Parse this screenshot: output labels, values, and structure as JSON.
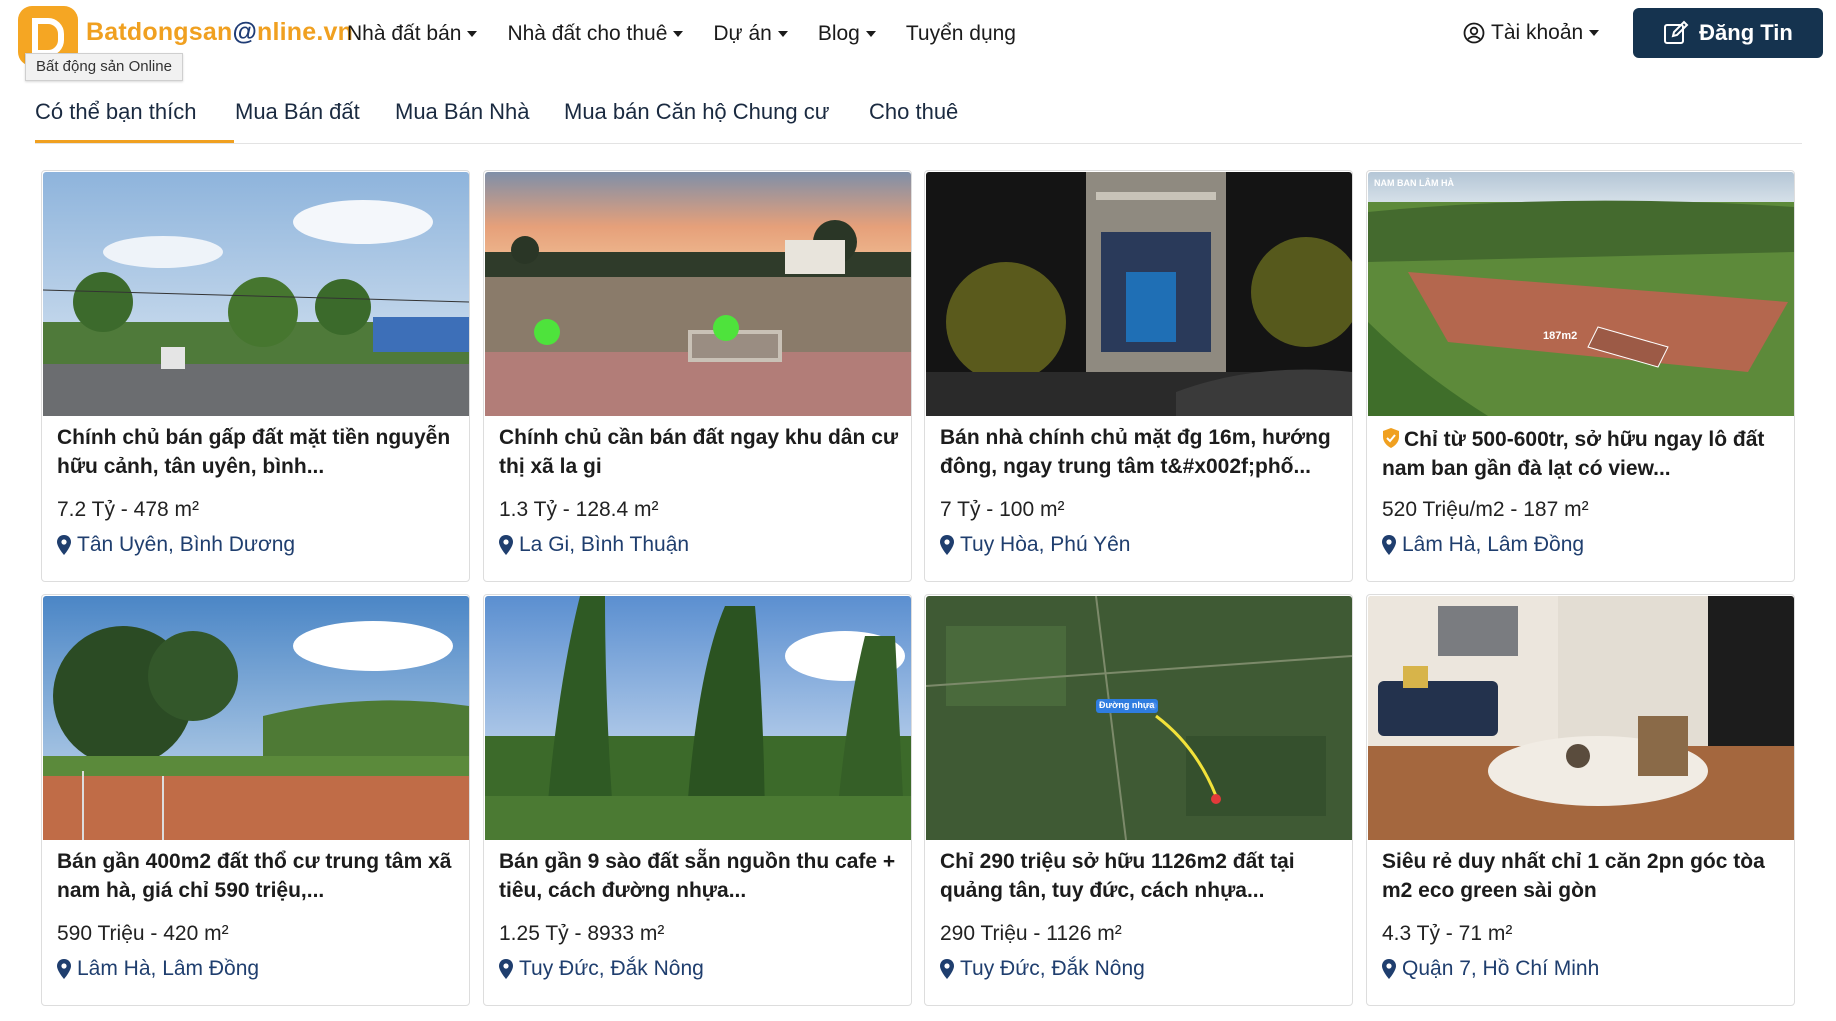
{
  "header": {
    "logo_text": "Batdongsan",
    "logo_text_at": "@",
    "logo_text_rest": "nline.vn",
    "logo_tooltip": "Bất động sản Online",
    "nav": [
      {
        "label": "Nhà đất bán",
        "has_caret": true
      },
      {
        "label": "Nhà đất cho thuê",
        "has_caret": true
      },
      {
        "label": "Dự án",
        "has_caret": true
      },
      {
        "label": "Blog",
        "has_caret": true
      },
      {
        "label": "Tuyển dụng",
        "has_caret": false
      }
    ],
    "account_label": "Tài khoản",
    "post_button_label": "Đăng Tin",
    "accent_color": "#f0a020",
    "button_color": "#15334f"
  },
  "tabs": [
    {
      "label": "Có thể bạn thích",
      "active": true
    },
    {
      "label": "Mua Bán đất",
      "active": false
    },
    {
      "label": "Mua Bán Nhà",
      "active": false
    },
    {
      "label": "Mua bán Căn hộ Chung cư",
      "active": false
    },
    {
      "label": "Cho thuê",
      "active": false
    }
  ],
  "listings": [
    {
      "title": "Chính chủ bán gấp đất mặt tiền nguyễn hữu cảnh, tân uyên, bình...",
      "price": "7.2 Tỷ - 478 m²",
      "location": "Tân Uyên, Bình Dương",
      "image": "street-scene"
    },
    {
      "title": "Chính chủ cần bán đất ngay khu dân cư thị xã la gi",
      "price": "1.3 Tỷ - 128.4 m²",
      "location": "La Gi, Bình Thuận",
      "image": "empty-lot-sunset"
    },
    {
      "title": "Bán nhà chính chủ mặt đg 16m, hướng đông, ngay trung tâm t&#x002f;phố...",
      "price": "7 Tỷ - 100 m²",
      "location": "Tuy Hòa, Phú Yên",
      "image": "house-night"
    },
    {
      "title": "Chỉ từ 500-600tr, sở hữu ngay lô đất nam ban gần đà lạt có view...",
      "price": "520 Triệu/m2 - 187 m²",
      "location": "Lâm Hà, Lâm Đồng",
      "image": "aerial-valley",
      "verified_badge": true,
      "image_label_top": "NAM BAN LÂM HÀ",
      "image_label_plot": "187m2"
    },
    {
      "title": "Bán gần 400m2 đất thổ cư trung tâm xã nam hà, giá chỉ 590 triệu,...",
      "price": "590 Triệu - 420 m²",
      "location": "Lâm Hà, Lâm Đồng",
      "image": "forest-lot"
    },
    {
      "title": "Bán gần 9 sào đất sẵn nguồn thu cafe + tiêu, cách đường nhựa...",
      "price": "1.25 Tỷ - 8933 m²",
      "location": "Tuy Đức, Đắk Nông",
      "image": "pepper-farm"
    },
    {
      "title": "Chỉ 290 triệu sở hữu 1126m2 đất tại quảng tân, tuy đức, cách nhựa...",
      "price": "290 Triệu - 1126 m²",
      "location": "Tuy Đức, Đắk Nông",
      "image": "satellite-map",
      "map_labels": [
        "Đường nhựa"
      ]
    },
    {
      "title": "Siêu rẻ duy nhất chỉ 1 căn 2pn góc tòa m2 eco green sài gòn",
      "price": "4.3 Tỷ - 71 m²",
      "location": "Quận 7, Hồ Chí Minh",
      "image": "apartment-interior"
    }
  ]
}
